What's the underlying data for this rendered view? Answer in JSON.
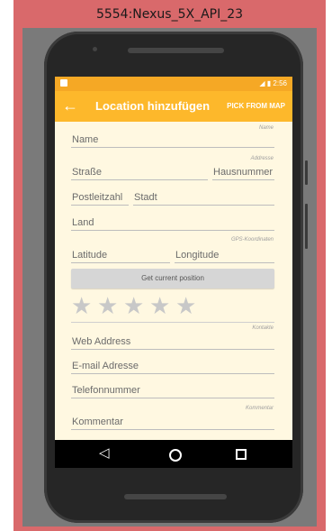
{
  "emulator": {
    "title": "5554:Nexus_5X_API_23"
  },
  "statusbar": {
    "time": "2:56",
    "signal_icon": "signal-icon",
    "battery_icon": "battery-icon"
  },
  "toolbar": {
    "title": "Location hinzufügen",
    "action": "PICK FROM MAP",
    "back_icon": "back-arrow-icon"
  },
  "sections": {
    "name": "Name",
    "address": "Addresse",
    "gps": "GPS-Koordinaten",
    "contacts": "Kontakte",
    "comment": "Kommentar"
  },
  "fields": {
    "name": {
      "placeholder": "Name",
      "value": ""
    },
    "street": {
      "placeholder": "Straße",
      "value": ""
    },
    "house_number": {
      "placeholder": "Hausnummer",
      "value": ""
    },
    "postal_code": {
      "placeholder": "Postleitzahl",
      "value": ""
    },
    "city": {
      "placeholder": "Stadt",
      "value": ""
    },
    "country": {
      "placeholder": "Land",
      "value": ""
    },
    "latitude": {
      "placeholder": "Latitude",
      "value": ""
    },
    "longitude": {
      "placeholder": "Longitude",
      "value": ""
    },
    "web_address": {
      "placeholder": "Web Address",
      "value": ""
    },
    "email": {
      "placeholder": "E-mail Adresse",
      "value": ""
    },
    "phone": {
      "placeholder": "Telefonnummer",
      "value": ""
    },
    "comment": {
      "placeholder": "Kommentar",
      "value": ""
    }
  },
  "gps_button": {
    "label": "Get current position"
  },
  "rating": {
    "value": 0,
    "max": 5,
    "star_char": "★"
  },
  "navbar": {
    "back_icon": "back-triangle-icon",
    "home_icon": "home-circle-icon",
    "recents_icon": "recents-square-icon"
  },
  "colors": {
    "accent": "#fdb82b",
    "statusbar": "#f5a825",
    "background": "#fff8e1",
    "emulator_frame": "#d9696b"
  }
}
